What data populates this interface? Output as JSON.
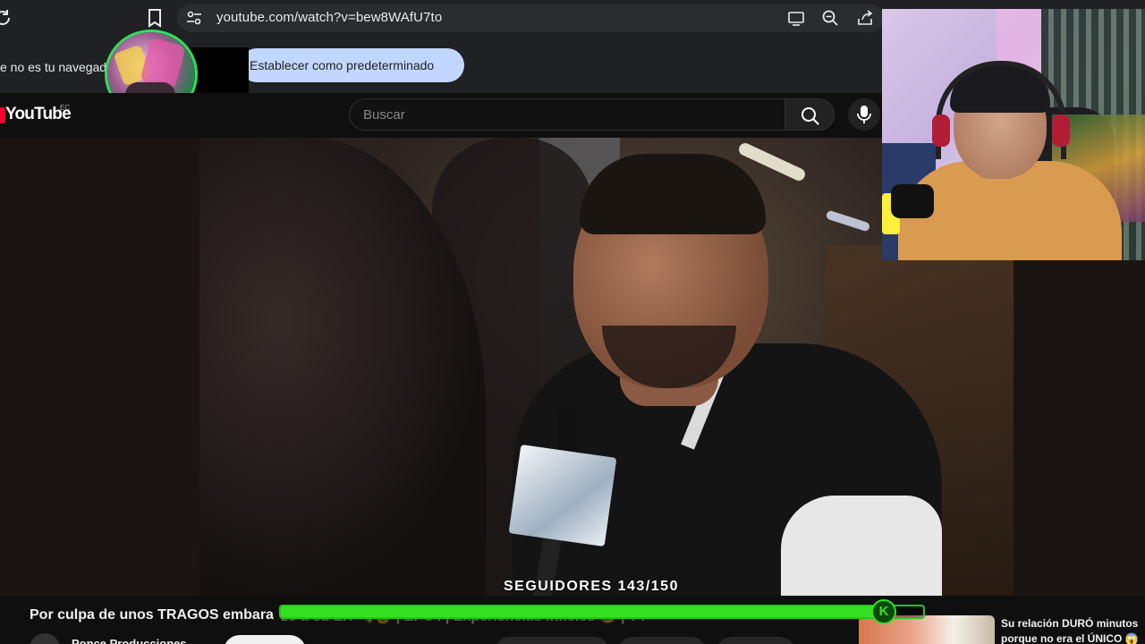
{
  "browser": {
    "url": "youtube.com/watch?v=bew8WAfU7to",
    "infobar_text": "e no es tu navegad",
    "set_default_button": "Establecer como predeterminado"
  },
  "youtube": {
    "logo_text": "YouTube",
    "region_code": "EC",
    "search_placeholder": "Buscar"
  },
  "overlay": {
    "followers_label": "SEGUIDORES 143/150",
    "followers_current": 143,
    "followers_goal": 150,
    "followers_fraction": 0.953,
    "badge_letter": "K",
    "bar_color": "#35df22"
  },
  "video": {
    "title": "Por culpa de unos TRAGOS embara",
    "title_tail": "zó a su EX 🍾👶 | EPC4 | Experiencias Infieles 🥲 | T4",
    "channel": "Ponce Producciones"
  },
  "recommendation": {
    "title": "Su relación DURÓ minutos porque no era el ÚNICO 😱"
  },
  "icons": [
    "reload-icon",
    "bookmark-icon",
    "site-settings-icon",
    "cast-icon",
    "zoom-icon",
    "share-icon",
    "search-icon",
    "mic-icon"
  ]
}
